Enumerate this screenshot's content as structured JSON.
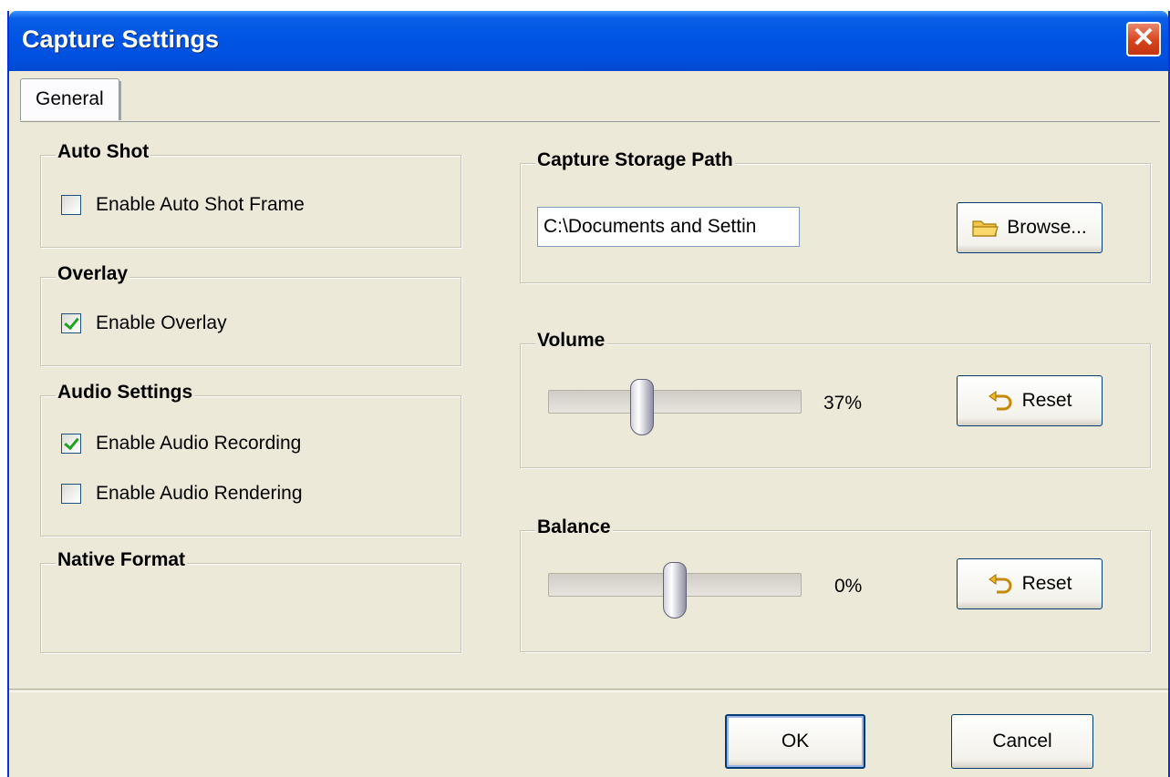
{
  "window": {
    "title": "Capture Settings",
    "close_label": "✕"
  },
  "tabs": [
    {
      "label": "General",
      "active": true
    }
  ],
  "auto_shot": {
    "title": "Auto Shot",
    "enable_auto_shot_frame": {
      "label": "Enable Auto Shot Frame",
      "checked": false
    }
  },
  "overlay": {
    "title": "Overlay",
    "enable_overlay": {
      "label": "Enable Overlay",
      "checked": true
    }
  },
  "audio_settings": {
    "title": "Audio Settings",
    "enable_audio_recording": {
      "label": "Enable Audio Recording",
      "checked": true
    },
    "enable_audio_rendering": {
      "label": "Enable Audio Rendering",
      "checked": false
    }
  },
  "native_format": {
    "title": "Native Format"
  },
  "storage": {
    "title": "Capture Storage Path",
    "path_value": "C:\\Documents and Settin",
    "browse_label": "Browse...",
    "browse_icon": "folder-icon"
  },
  "volume": {
    "title": "Volume",
    "value_text": "37%",
    "level": 0.37,
    "reset_label": "Reset",
    "reset_icon": "reset-icon"
  },
  "balance": {
    "title": "Balance",
    "value_text": "0%",
    "level": 0.5,
    "reset_label": "Reset",
    "reset_icon": "reset-icon"
  },
  "footer": {
    "ok_label": "OK",
    "cancel_label": "Cancel"
  },
  "colors": {
    "titlebar": "#0054e3",
    "dialog_bg": "#ece9d8",
    "close_button": "#d8431d",
    "check_mark": "#21a121"
  }
}
